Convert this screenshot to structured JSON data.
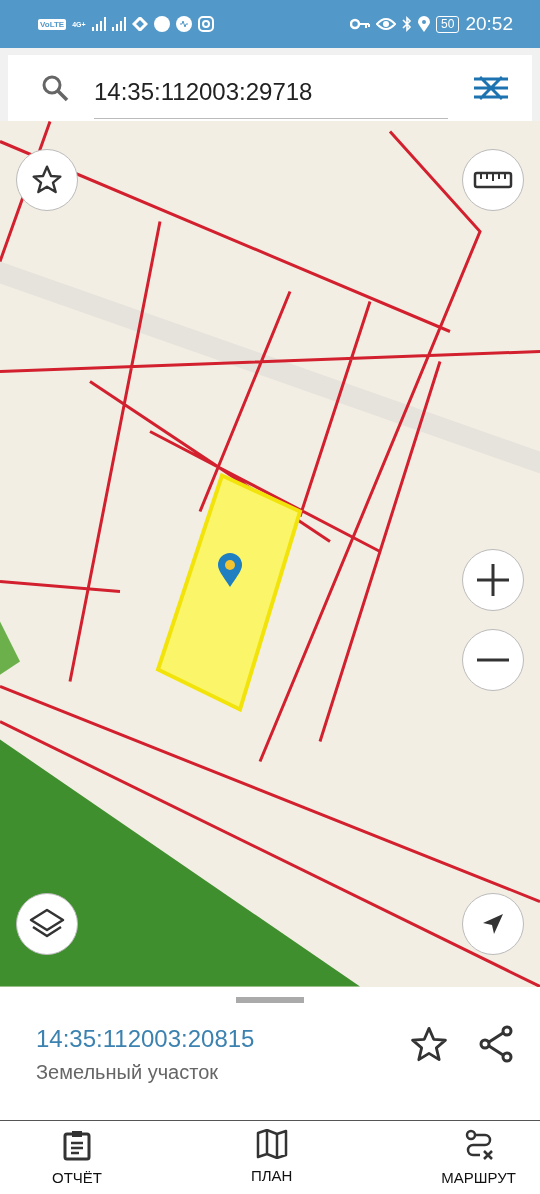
{
  "status_bar": {
    "network_label": "VoLTE",
    "signal_label": "4G+",
    "battery": "50",
    "time": "20:52"
  },
  "search": {
    "value": "14:35:112003:29718"
  },
  "place": {
    "cadastral_number": "14:35:112003:20815",
    "type": "Земельный участок",
    "favorite": false
  },
  "bottom_nav": [
    {
      "label": "ОТЧЁТ",
      "kind": "report"
    },
    {
      "label": "ПЛАН",
      "kind": "plan"
    },
    {
      "label": "МАРШРУТ",
      "kind": "route"
    }
  ]
}
